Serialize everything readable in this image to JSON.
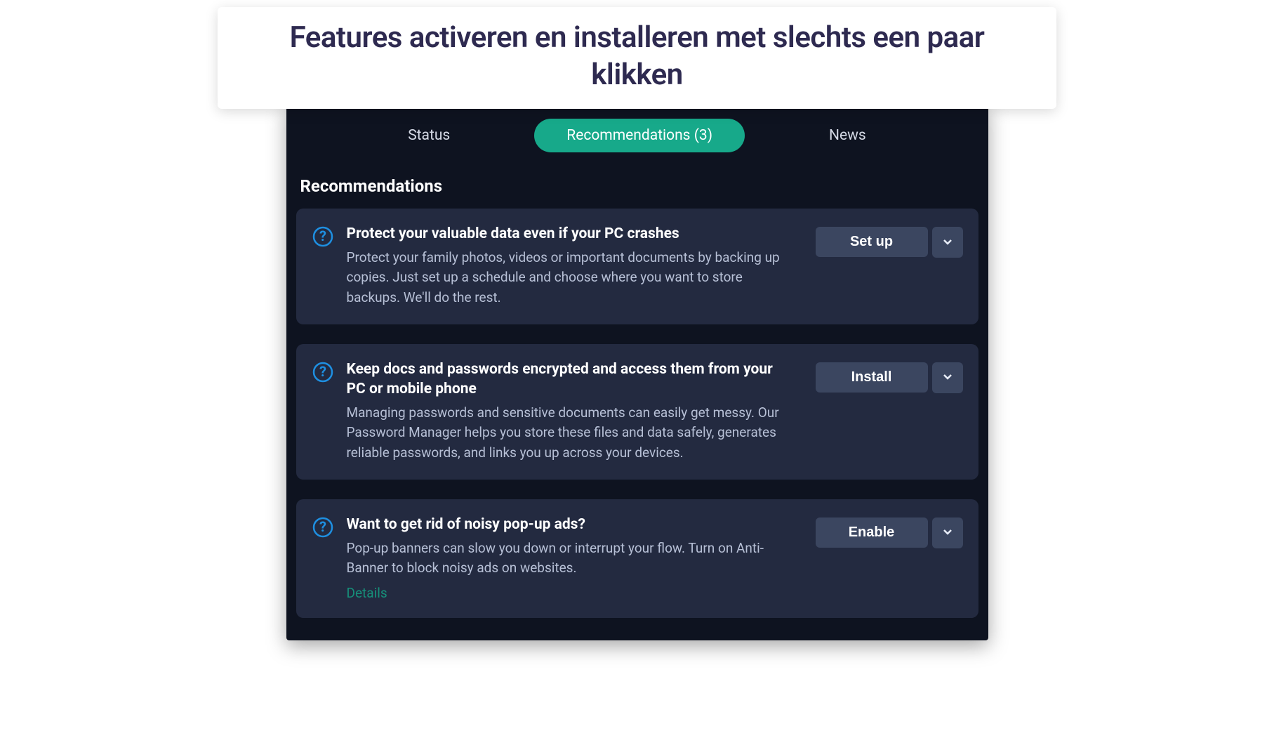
{
  "banner": {
    "title": "Features activeren en installeren met slechts een paar klikken"
  },
  "tabs": {
    "status": "Status",
    "recommendations": "Recommendations (3)",
    "news": "News"
  },
  "section_title": "Recommendations",
  "cards": [
    {
      "title": "Protect your valuable data even if your PC crashes",
      "desc": "Protect your family photos, videos or important documents by backing up copies. Just set up a schedule and choose where you want to store backups. We'll do the rest.",
      "action": "Set up"
    },
    {
      "title": "Keep docs and passwords encrypted and access them from your PC or mobile phone",
      "desc": "Managing passwords and sensitive documents can easily get messy. Our Password Manager helps you store these files and data safely, generates reliable passwords, and links you up across your devices.",
      "action": "Install"
    },
    {
      "title": "Want to get rid of noisy pop-up ads?",
      "desc": "Pop-up banners can slow you down or interrupt your flow. Turn on Anti-Banner to block noisy ads on websites.",
      "action": "Enable",
      "details": "Details"
    }
  ]
}
